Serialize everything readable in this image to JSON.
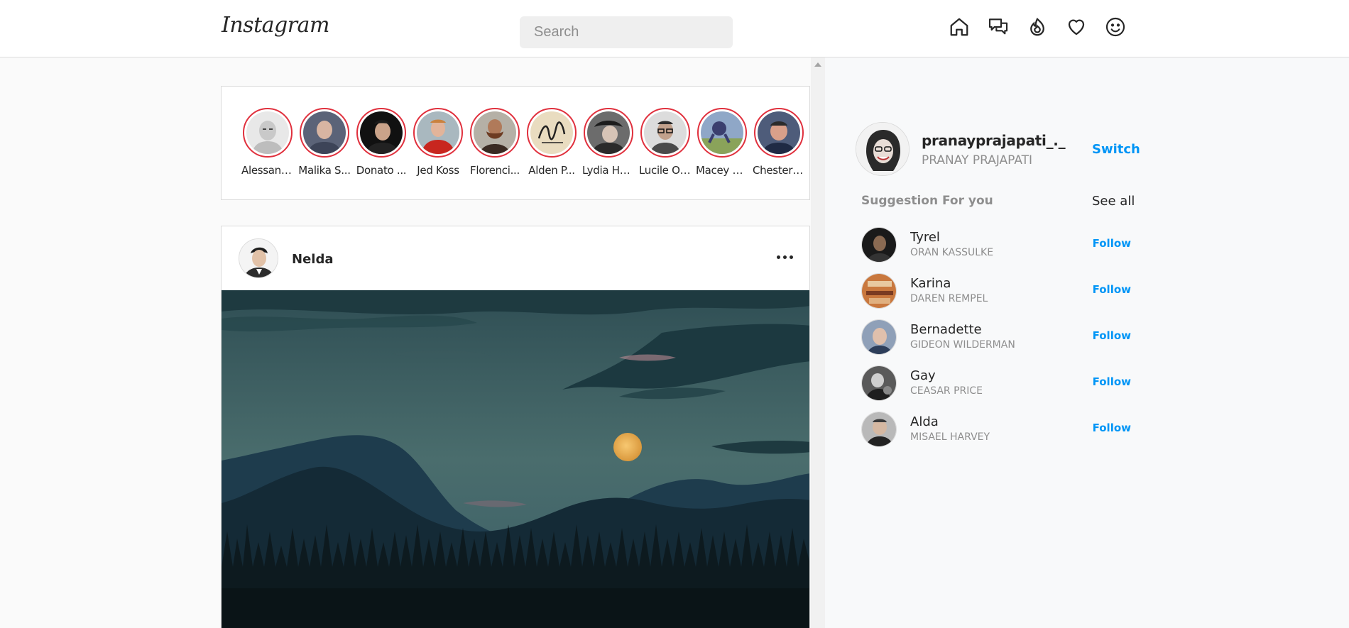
{
  "header": {
    "logo": "Instagram",
    "search_placeholder": "Search",
    "icons": [
      "home-icon",
      "messages-icon",
      "explore-icon",
      "activity-heart-icon",
      "profile-icon"
    ]
  },
  "stories": [
    {
      "name": "Alessand..."
    },
    {
      "name": "Malika S..."
    },
    {
      "name": "Donato ..."
    },
    {
      "name": "Jed Koss"
    },
    {
      "name": "Florenci..."
    },
    {
      "name": "Alden P..."
    },
    {
      "name": "Lydia He..."
    },
    {
      "name": "Lucile O'..."
    },
    {
      "name": "Macey O..."
    },
    {
      "name": "Chester ..."
    }
  ],
  "post": {
    "username": "Nelda"
  },
  "profile": {
    "username": "pranayprajapati_._",
    "fullname": "PRANAY PRAJAPATI",
    "switch_label": "Switch"
  },
  "suggestions": {
    "title": "Suggestion For you",
    "see_all_label": "See all",
    "follow_label": "Follow",
    "items": [
      {
        "name": "Tyrel",
        "subtitle": "ORAN KASSULKE"
      },
      {
        "name": "Karina",
        "subtitle": "DAREN REMPEL"
      },
      {
        "name": "Bernadette",
        "subtitle": "GIDEON WILDERMAN"
      },
      {
        "name": "Gay",
        "subtitle": "CEASAR PRICE"
      },
      {
        "name": "Alda",
        "subtitle": "MISAEL HARVEY"
      }
    ]
  },
  "colors": {
    "story_ring": "#e0303d",
    "link_blue": "#0095f6"
  }
}
